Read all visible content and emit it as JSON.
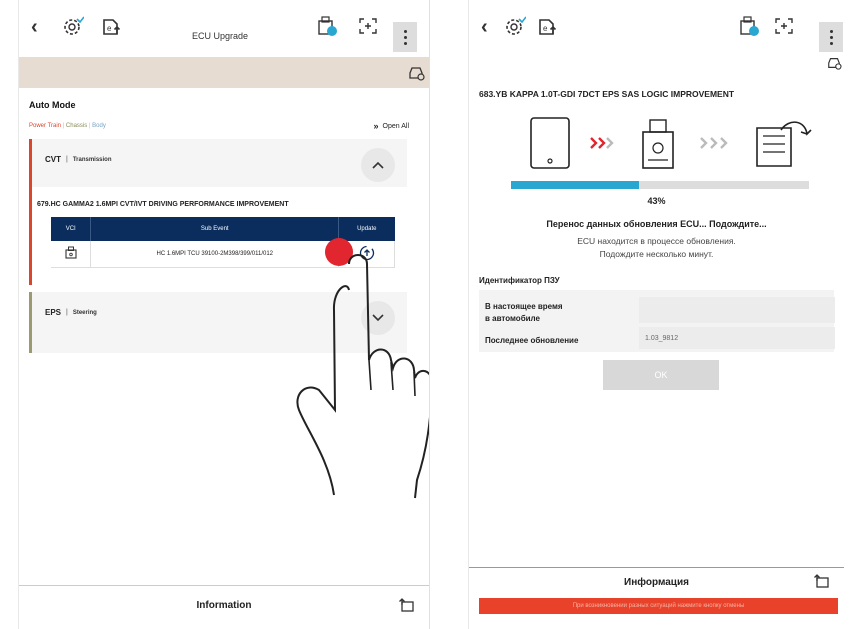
{
  "left": {
    "title": "ECU Upgrade",
    "auto_mode": "Auto Mode",
    "categories": [
      {
        "label": "Power Train",
        "color": "#d9462e"
      },
      {
        "label": "Chassis",
        "color": "#8a8a5a"
      },
      {
        "label": "Body",
        "color": "#7aa0c0"
      }
    ],
    "open_all": "Open All",
    "cvt": {
      "name": "CVT",
      "sep": "|",
      "sub": "Transmission"
    },
    "event_title": "679.HC GAMMA2 1.6MPI CVT/IVT DRIVING PERFORMANCE IMPROVEMENT",
    "table": {
      "headers": [
        "VCI",
        "Sub Event",
        "Update"
      ],
      "rows": [
        {
          "sub_event": "HC 1.6MPI TCU 39100-2M398/399/011/012"
        }
      ]
    },
    "eps": {
      "name": "EPS",
      "sep": "|",
      "sub": "Steering"
    },
    "footer": "Information"
  },
  "right": {
    "event_title": "683.YB KAPPA 1.0T-GDI 7DCT EPS SAS LOGIC IMPROVEMENT",
    "progress": {
      "value": 43,
      "label": "43%"
    },
    "status_main": "Перенос данных обновления ECU... Подождите...",
    "status_sub1": "ECU находится в процессе обновления.",
    "status_sub2": "Подождите несколько минут.",
    "id_heading": "Идентификатор ПЗУ",
    "current_label_1": "В настоящее время",
    "current_label_2": "в автомобиле",
    "current_value": "",
    "last_label": "Последнее обновление",
    "last_value": "1.03_9812",
    "ok": "OK",
    "footer": "Информация",
    "banner": "При возникновении разных ситуаций нажмите кнопку отмены"
  },
  "colors": {
    "navy": "#0a2d5e",
    "progress": "#2aa7d0",
    "accent_red": "#d9462e",
    "accent_olive": "#9c9a70",
    "banner": "#e8432a",
    "press": "#e1262f"
  }
}
